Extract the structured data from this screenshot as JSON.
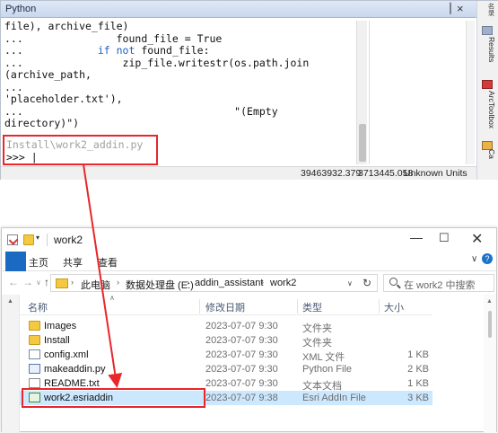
{
  "python_window": {
    "title": "Python",
    "pin_glyph": "▕",
    "close_glyph": "×",
    "console_lines": [
      {
        "pre": "file), archive_file)",
        "kw": "",
        "post": ""
      },
      {
        "pre": "...               found_file = True",
        "kw": "",
        "post": ""
      },
      {
        "pre": "...            ",
        "kw": "if not",
        "post": " found_file:"
      },
      {
        "pre": "...                zip_file.writestr(os.path.join",
        "kw": "",
        "post": ""
      },
      {
        "pre": "(archive_path,",
        "kw": "",
        "post": ""
      },
      {
        "pre": "...",
        "kw": "",
        "post": ""
      },
      {
        "pre": "'placeholder.txt'),",
        "kw": "",
        "post": ""
      },
      {
        "pre": "...                                  \"(Empty",
        "kw": "",
        "post": ""
      },
      {
        "pre": "directory)\")",
        "kw": "",
        "post": ""
      }
    ],
    "prompt_command": "Install\\work2_addin.py",
    "prompt": ">>> |",
    "status": {
      "x": "39463932.379",
      "y": "3713445.058",
      "units": "Unknown Units"
    },
    "side_tabs": {
      "top": "名录",
      "results": "Results",
      "arctoolbox": "ArcToolbox",
      "catalog": "Ca"
    }
  },
  "explorer": {
    "title": "work2",
    "quick_access_arrow": "▾",
    "window_buttons": {
      "minimize": "—",
      "maximize": "☐",
      "close": "✕"
    },
    "ribbon_tabs": {
      "file": "",
      "home": "主页",
      "share": "共享",
      "view": "查看"
    },
    "ribbon_expand": "∨",
    "ribbon_help": "?",
    "nav": {
      "back": "←",
      "forward": "→",
      "down": "∨",
      "up": "↑"
    },
    "breadcrumb": {
      "separator": "›",
      "items": [
        "此电脑",
        "数据处理盘 (E:)",
        "addin_assistant",
        "work2"
      ]
    },
    "address_dropdown": "∨",
    "refresh": "↻",
    "search_placeholder": "在 work2 中搜索",
    "columns": {
      "name": "名称",
      "date": "修改日期",
      "type": "类型",
      "size": "大小"
    },
    "sort_caret": "∧",
    "files": [
      {
        "icon": "folder-icon",
        "name": "Images",
        "date": "2023-07-07 9:30",
        "type": "文件夹",
        "size": ""
      },
      {
        "icon": "folder-icon",
        "name": "Install",
        "date": "2023-07-07 9:30",
        "type": "文件夹",
        "size": ""
      },
      {
        "icon": "xml-file-icon",
        "name": "config.xml",
        "date": "2023-07-07 9:30",
        "type": "XML 文件",
        "size": "1 KB"
      },
      {
        "icon": "python-file-icon",
        "name": "makeaddin.py",
        "date": "2023-07-07 9:30",
        "type": "Python File",
        "size": "2 KB"
      },
      {
        "icon": "text-file-icon",
        "name": "README.txt",
        "date": "2023-07-07 9:30",
        "type": "文本文档",
        "size": "1 KB"
      },
      {
        "icon": "esri-addin-icon",
        "name": "work2.esriaddin",
        "date": "2023-07-07 9:38",
        "type": "Esri AddIn File",
        "size": "3 KB"
      }
    ],
    "selected_file": "work2.esriaddin"
  },
  "colors": {
    "highlight": "#e8262b",
    "selection": "#cce8ff",
    "ribbon_file_tab": "#1a6ac2"
  }
}
